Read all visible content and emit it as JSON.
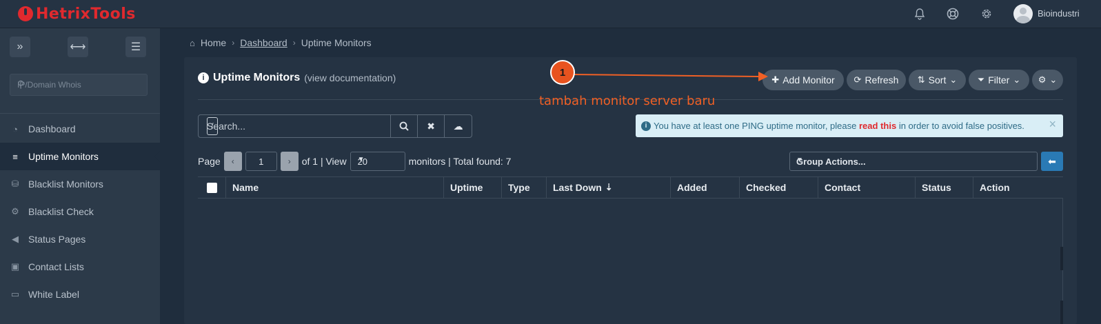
{
  "brand": {
    "logo_text": "HetrixTools",
    "accent": "#e0292e"
  },
  "topbar": {
    "icons": [
      "bell-icon",
      "lifebuoy-icon",
      "gear-icon"
    ],
    "username": "Bioindustri"
  },
  "sidebar": {
    "tool_icons": [
      "double-chevron-right-icon",
      "horizontal-resize-icon",
      "hamburger-menu-icon"
    ],
    "search_placeholder": "IP/Domain Whois",
    "items": [
      {
        "label": "Dashboard",
        "icon": "dashboard-icon"
      },
      {
        "label": "Uptime Monitors",
        "icon": "server-icon",
        "active": true
      },
      {
        "label": "Blacklist Monitors",
        "icon": "database-icon"
      },
      {
        "label": "Blacklist Check",
        "icon": "cogs-icon"
      },
      {
        "label": "Status Pages",
        "icon": "bullhorn-icon"
      },
      {
        "label": "Contact Lists",
        "icon": "contact-book-icon"
      },
      {
        "label": "White Label",
        "icon": "label-icon"
      }
    ]
  },
  "breadcrumb": {
    "home": "Home",
    "sep": "›",
    "dashboard": "Dashboard",
    "current": "Uptime Monitors"
  },
  "panel": {
    "title": "Uptime Monitors",
    "doc_open": "(",
    "doc_link": "view documentation",
    "doc_close": ")",
    "buttons": {
      "add": "Add Monitor",
      "refresh": "Refresh",
      "sort": "Sort",
      "filter": "Filter"
    }
  },
  "annotation": {
    "number": "1",
    "text": "tambah monitor server baru",
    "color": "#f06025"
  },
  "search": {
    "placeholder": "Search...",
    "shortcut": "/"
  },
  "alert": {
    "text_before": "You have at least one PING uptime monitor, please",
    "link": "read this",
    "text_after": "in order to avoid false positives.",
    "close": "×"
  },
  "pager": {
    "page_label": "Page",
    "page_value": "1",
    "of_text": "of 1 | View",
    "view_value": "20",
    "summary": "monitors | Total found: 7",
    "prev": "‹",
    "next": "›"
  },
  "group_actions": {
    "value": "Group Actions..."
  },
  "table": {
    "columns": [
      "Name",
      "Uptime",
      "Type",
      "Last Down",
      "Added",
      "Checked",
      "Contact",
      "Status",
      "Action"
    ]
  }
}
